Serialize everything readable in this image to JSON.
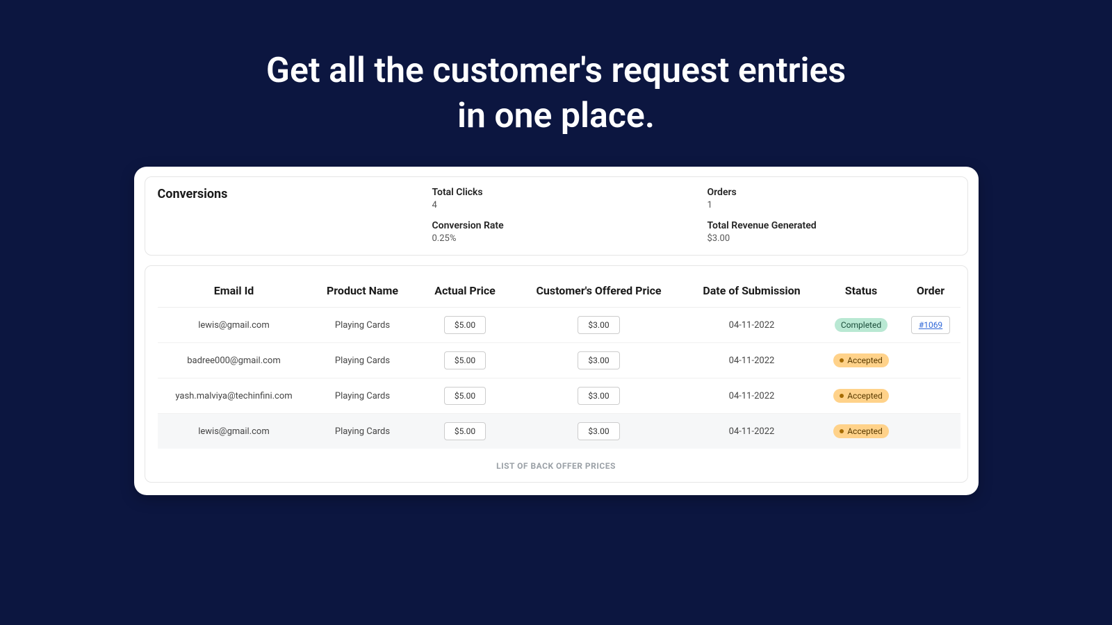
{
  "headline_line1": "Get all the customer's request entries",
  "headline_line2": "in one place.",
  "conversions": {
    "title": "Conversions",
    "total_clicks_label": "Total Clicks",
    "total_clicks_value": "4",
    "orders_label": "Orders",
    "orders_value": "1",
    "conversion_rate_label": "Conversion Rate",
    "conversion_rate_value": "0.25%",
    "total_revenue_label": "Total Revenue Generated",
    "total_revenue_value": "$3.00"
  },
  "table": {
    "headers": {
      "email": "Email Id",
      "product": "Product Name",
      "actual": "Actual Price",
      "offered": "Customer's Offered Price",
      "date": "Date of Submission",
      "status": "Status",
      "order": "Order"
    },
    "rows": [
      {
        "email": "lewis@gmail.com",
        "product": "Playing Cards",
        "actual": "$5.00",
        "offered": "$3.00",
        "date": "04-11-2022",
        "status": "Completed",
        "status_kind": "completed",
        "order_link": "#1069"
      },
      {
        "email": "badree000@gmail.com",
        "product": "Playing Cards",
        "actual": "$5.00",
        "offered": "$3.00",
        "date": "04-11-2022",
        "status": "Accepted",
        "status_kind": "accepted",
        "order_link": ""
      },
      {
        "email": "yash.malviya@techinfini.com",
        "product": "Playing Cards",
        "actual": "$5.00",
        "offered": "$3.00",
        "date": "04-11-2022",
        "status": "Accepted",
        "status_kind": "accepted",
        "order_link": ""
      },
      {
        "email": "lewis@gmail.com",
        "product": "Playing Cards",
        "actual": "$5.00",
        "offered": "$3.00",
        "date": "04-11-2022",
        "status": "Accepted",
        "status_kind": "accepted",
        "order_link": ""
      }
    ]
  },
  "footer_label": "LIST OF BACK OFFER PRICES"
}
